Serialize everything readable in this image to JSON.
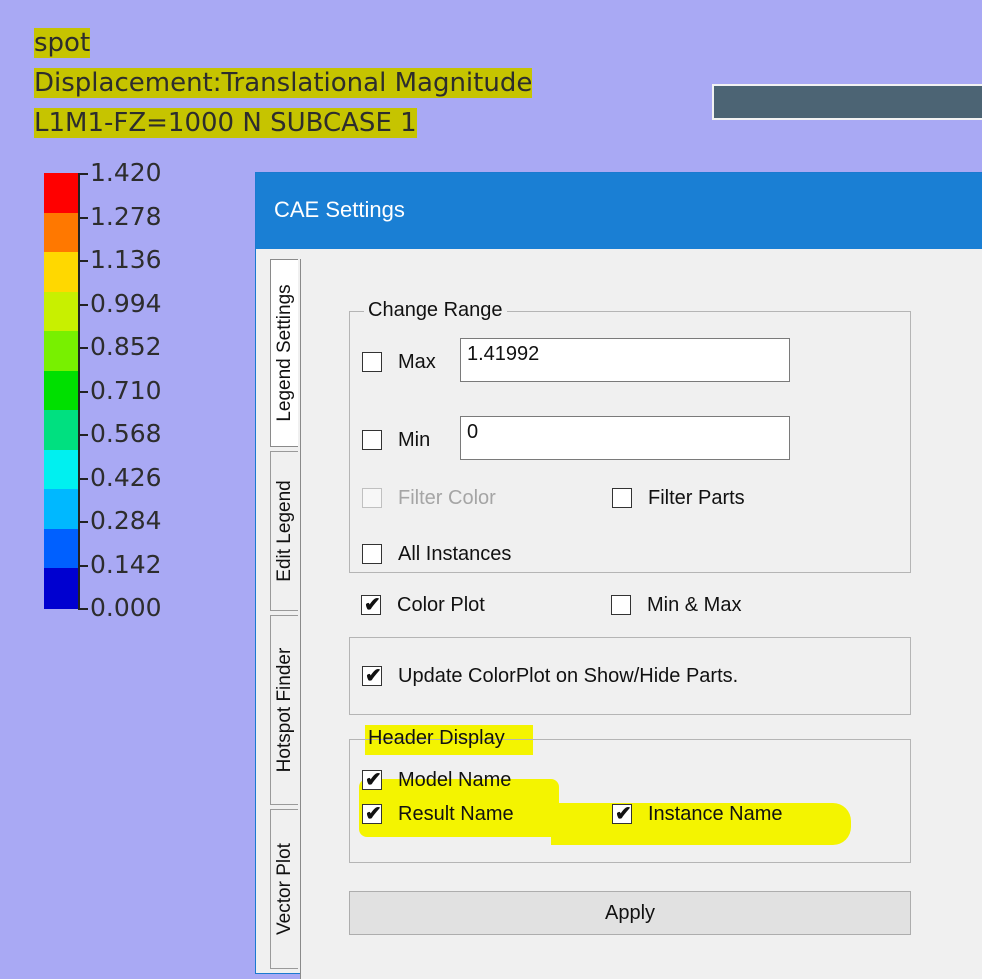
{
  "viewport_header": {
    "model": "spot",
    "result": "Displacement:Translational Magnitude",
    "instance": "L1M1-FZ=1000 N SUBCASE 1"
  },
  "legend": {
    "labels": [
      "1.420",
      "1.278",
      "1.136",
      "0.994",
      "0.852",
      "0.710",
      "0.568",
      "0.426",
      "0.284",
      "0.142",
      "0.000"
    ],
    "colors": [
      "#ff0000",
      "#ff7800",
      "#ffd800",
      "#c8f000",
      "#78f000",
      "#00e000",
      "#00e080",
      "#00f0f0",
      "#00b8ff",
      "#0060ff",
      "#0000d0"
    ]
  },
  "dialog": {
    "title": "CAE Settings",
    "tabs": [
      "Legend Settings",
      "Edit Legend",
      "Hotspot Finder",
      "Vector Plot"
    ],
    "change_range": {
      "title": "Change Range",
      "max_label": "Max",
      "max_value": "1.41992",
      "min_label": "Min",
      "min_value": "0",
      "filter_color": "Filter Color",
      "filter_parts": "Filter Parts",
      "all_instances": "All Instances"
    },
    "color_plot": "Color Plot",
    "min_max": "Min & Max",
    "update_colorplot": "Update ColorPlot on Show/Hide Parts.",
    "header_display": {
      "title": "Header Display",
      "model_name": "Model Name",
      "result_name": "Result Name",
      "instance_name": "Instance Name"
    },
    "apply": "Apply",
    "checkmark": "✔"
  }
}
